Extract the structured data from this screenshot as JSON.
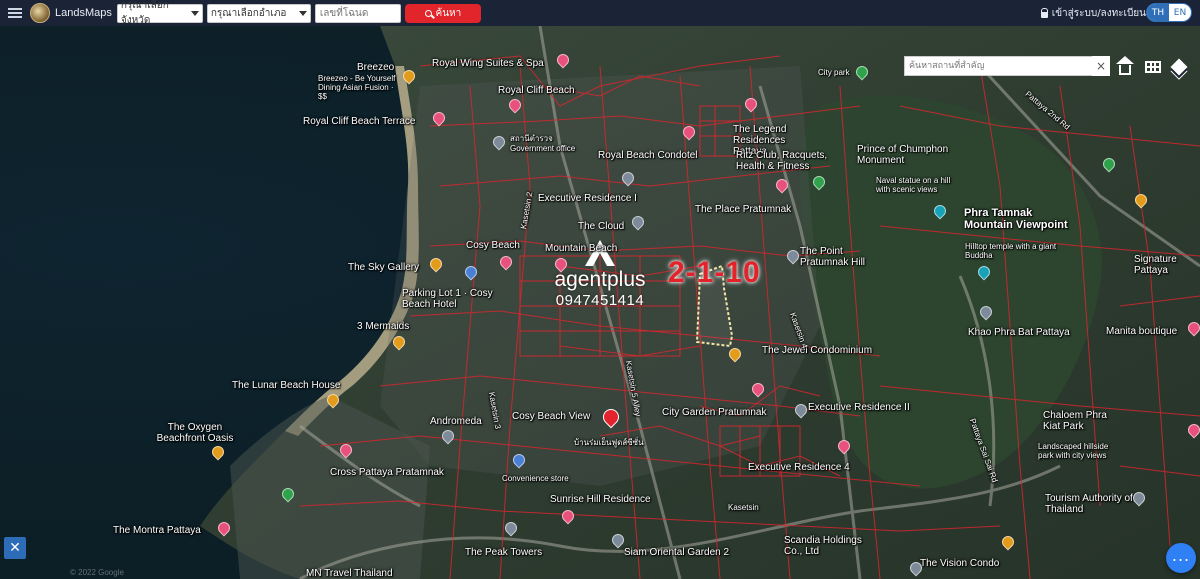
{
  "header": {
    "app_title": "LandsMaps",
    "province_select": "กรุณาเลือกจังหวัด",
    "district_select": "กรุณาเลือกอำเภอ",
    "deed_placeholder": "เลขที่โฉนด",
    "search_label": "ค้นหา",
    "login_label": "เข้าสู่ระบบ/ลงทะเบียน",
    "lang_th": "TH",
    "lang_en": "EN"
  },
  "map_controls": {
    "place_search_placeholder": "ค้นหาสถานที่สำคัญ",
    "clear_label": "×"
  },
  "parcel": {
    "number": "2-1-10"
  },
  "watermark": {
    "brand": "agentplus",
    "phone": "0947451414"
  },
  "map_labels": {
    "breezeo": "Breezeo",
    "breezeo_sub": "Breezeo - Be Yourself Dining Asian Fusion · $$",
    "royal_wing": "Royal Wing Suites & Spa",
    "royal_cliff": "Royal Cliff Beach",
    "royal_cliff_terrace": "Royal Cliff Beach Terrace",
    "gov_office": "สถานีตำรวจ Government office",
    "royal_beach_condotel": "Royal Beach Condotel",
    "legend": "The Legend Residences Pattaya",
    "ritz_club": "Ritz Club, Racquets, Health & Fitness",
    "prince_chumphon": "Prince of Chumphon Monument",
    "naval_statue": "Naval statue on a hill with scenic views",
    "executive_residence_1": "Executive Residence I",
    "the_place": "The Place Pratumnak",
    "phra_tamnak": "Phra Tamnak Mountain Viewpoint",
    "phra_tamnak_sub": "Hilltop temple with a giant Buddha",
    "the_cloud": "The Cloud",
    "cosy_beach": "Cosy Beach",
    "mountain_beach": "Mountain Beach",
    "the_point": "The Point Pratumnak Hill",
    "sky_gallery": "The Sky Gallery",
    "parking_lot": "Parking Lot 1 · Cosy Beach Hotel",
    "signature": "Signature Pattaya",
    "three_mermaids": "3 Mermaids",
    "khao_phra_bat": "Khao Phra Bat Pattaya",
    "manita": "Manita boutique",
    "jewel": "The Jewel Condominium",
    "lunar_beach": "The Lunar Beach House",
    "oxygen": "The Oxygen Beachfront Oasis",
    "andromeda": "Andromeda",
    "cosy_beach_view": "Cosy Beach View",
    "city_garden": "City Garden Pratumnak",
    "executive_residence_2": "Executive Residence II",
    "chaloem": "Chaloem Phra Kiat Park",
    "landscaped": "Landscaped hillside park with city views",
    "cross_pattaya": "Cross Pattaya Pratamnak",
    "convenience": "Convenience store",
    "executive_residence_4": "Executive Residence 4",
    "sunrise_hill": "Sunrise Hill Residence",
    "tourism": "Tourism Authority of Thailand",
    "montra": "The Montra Pattaya",
    "kasetsin": "Kasetsin",
    "peak_towers": "The Peak Towers",
    "siam_oriental": "Siam Oriental Garden 2",
    "scandia": "Scandia Holdings Co., Ltd",
    "vision_condo": "The Vision Condo",
    "mn_travel": "MN Travel Thailand",
    "pattaya_sai_rd": "Pattaya Sai Sai Rd",
    "pattaya_2nd_rd": "Pattaya 2nd Rd",
    "city_park": "City park",
    "kasetsin_2": "Kasetsin 2",
    "kasetsin_5": "Kasetsin 5 Alley",
    "kasetsin_3": "Kasetsin 3",
    "kasetsin_4": "Kasetsin 4",
    "thai_sub": "บ้านร่มเย็นฟูดส์ซีซั่น"
  },
  "colors": {
    "topbar_bg": "#1b2437",
    "search_btn": "#e2252b",
    "parcel_line": "#d8262e",
    "parcel_number": "#e4222a",
    "accent_blue": "#2f6fb8"
  },
  "footer": {
    "copyright": "© 2022 Google"
  }
}
